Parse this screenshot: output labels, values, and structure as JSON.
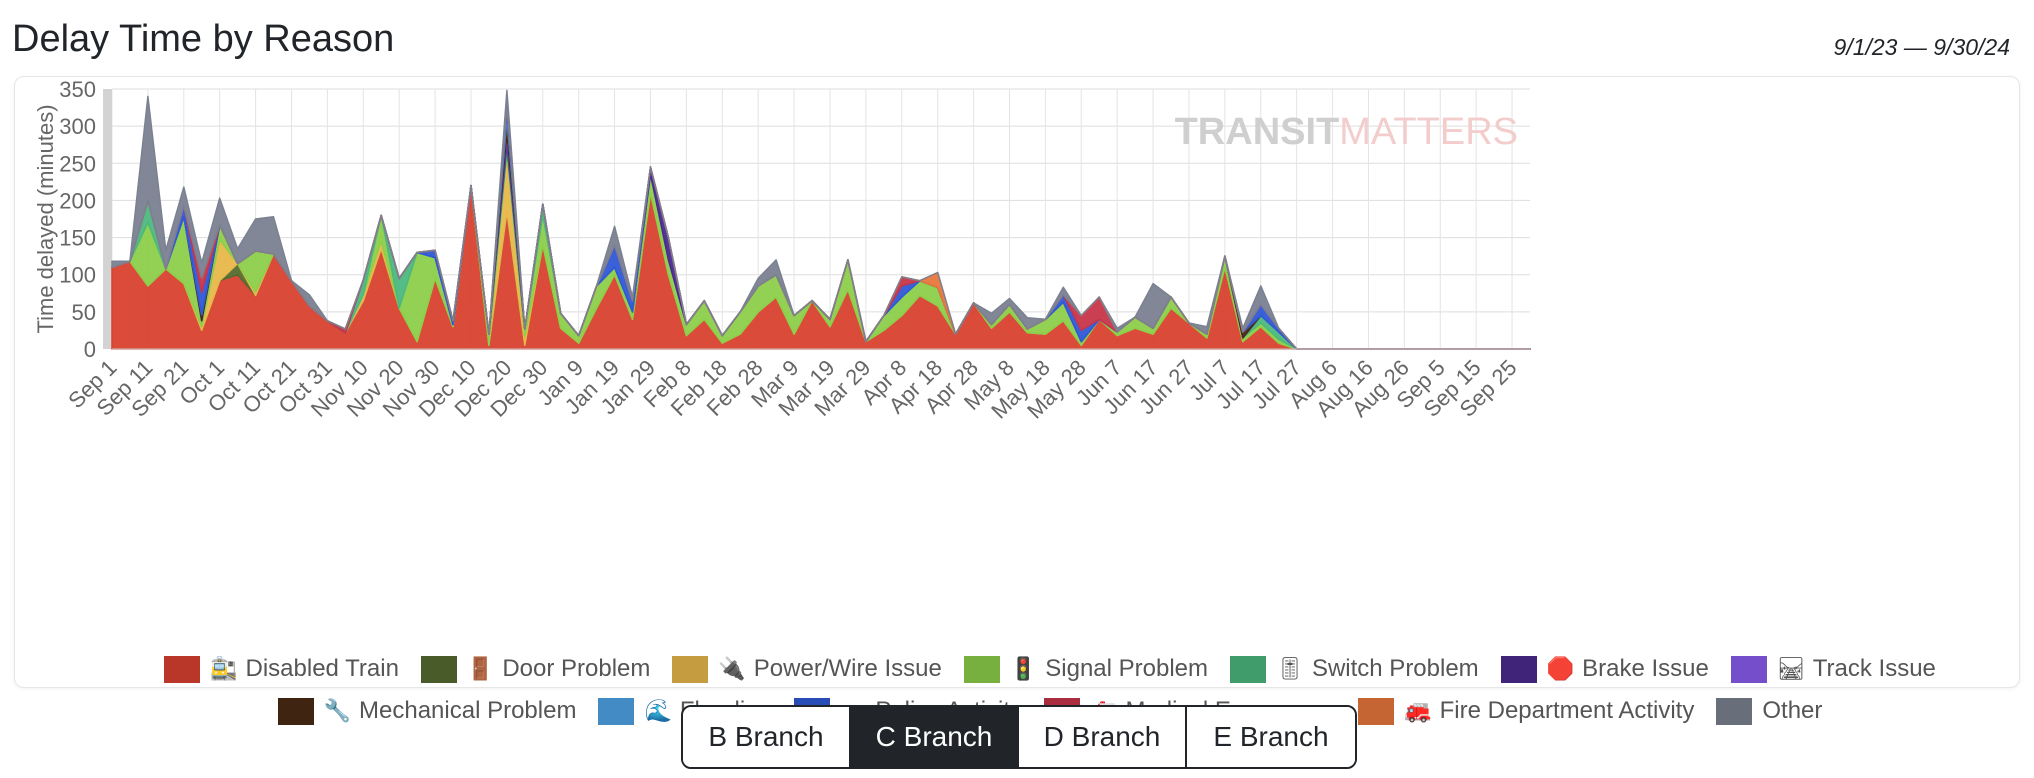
{
  "header": {
    "title": "Delay Time by Reason",
    "date_range": "9/1/23 — 9/30/24"
  },
  "branches": [
    {
      "label": "B Branch",
      "active": false
    },
    {
      "label": "C Branch",
      "active": true
    },
    {
      "label": "D Branch",
      "active": false
    },
    {
      "label": "E Branch",
      "active": false
    }
  ],
  "chart_data": {
    "type": "area",
    "stacked": true,
    "title": "",
    "ylabel": "Time delayed (minutes)",
    "xlabel": "",
    "ylim": [
      0,
      350
    ],
    "y_ticks": [
      0,
      50,
      100,
      150,
      200,
      250,
      300,
      350
    ],
    "x_tick_labels": [
      "Sep 1",
      "Sep 11",
      "Sep 21",
      "Oct 1",
      "Oct 11",
      "Oct 21",
      "Oct 31",
      "Nov 10",
      "Nov 20",
      "Nov 30",
      "Dec 10",
      "Dec 20",
      "Dec 30",
      "Jan 9",
      "Jan 19",
      "Jan 29",
      "Feb 8",
      "Feb 18",
      "Feb 28",
      "Mar 9",
      "Mar 19",
      "Mar 29",
      "Apr 8",
      "Apr 18",
      "Apr 28",
      "May 8",
      "May 18",
      "May 28",
      "Jun 7",
      "Jun 17",
      "Jun 27",
      "Jul 7",
      "Jul 17",
      "Jul 27",
      "Aug 6",
      "Aug 16",
      "Aug 26",
      "Sep 5",
      "Sep 15",
      "Sep 25"
    ],
    "x": [
      "2023-09-01",
      "2023-09-06",
      "2023-09-11",
      "2023-09-16",
      "2023-09-21",
      "2023-09-26",
      "2023-10-01",
      "2023-10-06",
      "2023-10-11",
      "2023-10-16",
      "2023-10-21",
      "2023-10-26",
      "2023-10-31",
      "2023-11-05",
      "2023-11-10",
      "2023-11-15",
      "2023-11-20",
      "2023-11-25",
      "2023-11-30",
      "2023-12-05",
      "2023-12-10",
      "2023-12-15",
      "2023-12-20",
      "2023-12-25",
      "2023-12-30",
      "2024-01-04",
      "2024-01-09",
      "2024-01-14",
      "2024-01-19",
      "2024-01-24",
      "2024-01-29",
      "2024-02-03",
      "2024-02-08",
      "2024-02-13",
      "2024-02-18",
      "2024-02-23",
      "2024-02-28",
      "2024-03-04",
      "2024-03-09",
      "2024-03-14",
      "2024-03-19",
      "2024-03-24",
      "2024-03-29",
      "2024-04-03",
      "2024-04-08",
      "2024-04-13",
      "2024-04-18",
      "2024-04-23",
      "2024-04-28",
      "2024-05-03",
      "2024-05-08",
      "2024-05-13",
      "2024-05-18",
      "2024-05-23",
      "2024-05-28",
      "2024-06-02",
      "2024-06-07",
      "2024-06-12",
      "2024-06-17",
      "2024-06-22",
      "2024-06-27",
      "2024-07-02",
      "2024-07-07",
      "2024-07-12",
      "2024-07-17",
      "2024-07-22",
      "2024-07-27",
      "2024-08-01",
      "2024-08-06",
      "2024-08-11",
      "2024-08-16",
      "2024-08-21",
      "2024-08-26",
      "2024-08-31",
      "2024-09-05",
      "2024-09-10",
      "2024-09-15",
      "2024-09-20",
      "2024-09-25",
      "2024-09-30"
    ],
    "series": [
      {
        "name": "Disabled Train",
        "icon": "🚉",
        "color": "#d9412f",
        "values": [
          110,
          118,
          85,
          108,
          88,
          25,
          92,
          100,
          72,
          128,
          92,
          58,
          38,
          22,
          65,
          135,
          55,
          10,
          95,
          30,
          220,
          5,
          185,
          5,
          140,
          28,
          8,
          55,
          100,
          40,
          210,
          100,
          18,
          40,
          8,
          20,
          50,
          70,
          20,
          65,
          30,
          80,
          10,
          25,
          45,
          72,
          58,
          20,
          62,
          28,
          50,
          22,
          20,
          38,
          5,
          40,
          18,
          28,
          20,
          55,
          35,
          15,
          110,
          10,
          30,
          8
        ]
      },
      {
        "name": "Door Problem",
        "icon": "🚪",
        "color": "#556b2f",
        "values": [
          0,
          0,
          0,
          0,
          0,
          0,
          0,
          15,
          0,
          0,
          0,
          0,
          0,
          0,
          0,
          0,
          0,
          0,
          0,
          0,
          0,
          0,
          0,
          0,
          0,
          0,
          0,
          0,
          0,
          0,
          0,
          0,
          0,
          0,
          0,
          0,
          0,
          0,
          0,
          0,
          0,
          0,
          0,
          0,
          0,
          0,
          0,
          0,
          0,
          0,
          0,
          0,
          0,
          0,
          0,
          0,
          0,
          0,
          0,
          0,
          0,
          0,
          0,
          0,
          0,
          0
        ]
      },
      {
        "name": "Power/Wire Issue",
        "icon": "🔌",
        "color": "#e8b84a",
        "values": [
          0,
          0,
          0,
          0,
          0,
          5,
          55,
          0,
          5,
          0,
          0,
          0,
          0,
          0,
          8,
          10,
          0,
          0,
          0,
          0,
          0,
          0,
          80,
          12,
          0,
          0,
          0,
          0,
          0,
          0,
          0,
          0,
          0,
          0,
          0,
          0,
          0,
          0,
          0,
          0,
          0,
          0,
          0,
          0,
          0,
          0,
          0,
          0,
          0,
          0,
          0,
          0,
          0,
          0,
          0,
          0,
          0,
          0,
          0,
          0,
          0,
          0,
          0,
          0,
          0,
          0
        ]
      },
      {
        "name": "Signal Problem",
        "icon": "🚦",
        "color": "#8ccf4a",
        "values": [
          0,
          0,
          85,
          0,
          90,
          8,
          20,
          0,
          55,
          0,
          0,
          0,
          0,
          0,
          0,
          35,
          0,
          120,
          28,
          3,
          0,
          15,
          0,
          10,
          40,
          20,
          10,
          30,
          10,
          10,
          25,
          20,
          15,
          25,
          10,
          30,
          35,
          30,
          25,
          0,
          10,
          40,
          0,
          20,
          25,
          20,
          25,
          0,
          0,
          5,
          10,
          5,
          20,
          25,
          5,
          0,
          5,
          15,
          8,
          15,
          0,
          5,
          15,
          5,
          5,
          5
        ]
      },
      {
        "name": "Switch Problem",
        "icon": "🎚",
        "color": "#4cb87e",
        "values": [
          0,
          0,
          30,
          0,
          0,
          0,
          0,
          0,
          0,
          0,
          0,
          0,
          0,
          0,
          20,
          0,
          40,
          0,
          0,
          0,
          0,
          0,
          10,
          0,
          15,
          0,
          0,
          0,
          0,
          0,
          0,
          0,
          0,
          0,
          0,
          0,
          0,
          0,
          0,
          0,
          0,
          0,
          0,
          0,
          0,
          0,
          0,
          0,
          0,
          0,
          0,
          0,
          0,
          0,
          0,
          0,
          0,
          0,
          0,
          0,
          0,
          0,
          0,
          0,
          10,
          10
        ]
      },
      {
        "name": "Brake Issue",
        "icon": "🛑",
        "color": "#4b2a8f",
        "values": [
          0,
          0,
          0,
          0,
          0,
          0,
          0,
          0,
          0,
          0,
          0,
          0,
          0,
          0,
          0,
          0,
          0,
          0,
          0,
          0,
          0,
          0,
          10,
          0,
          0,
          0,
          0,
          0,
          0,
          0,
          10,
          30,
          0,
          0,
          0,
          0,
          0,
          0,
          0,
          0,
          0,
          0,
          0,
          0,
          0,
          0,
          0,
          0,
          0,
          0,
          0,
          0,
          0,
          0,
          0,
          0,
          0,
          0,
          0,
          0,
          0,
          0,
          0,
          0,
          0,
          0
        ]
      },
      {
        "name": "Track Issue",
        "icon": "🛤",
        "color": "#8a5cf0",
        "values": [
          0,
          0,
          0,
          0,
          0,
          0,
          0,
          0,
          0,
          0,
          0,
          0,
          0,
          0,
          0,
          0,
          0,
          0,
          0,
          0,
          0,
          0,
          5,
          0,
          0,
          0,
          0,
          0,
          0,
          0,
          0,
          0,
          0,
          0,
          0,
          0,
          0,
          0,
          0,
          0,
          0,
          0,
          0,
          0,
          0,
          0,
          0,
          0,
          0,
          0,
          0,
          0,
          0,
          0,
          0,
          0,
          0,
          0,
          0,
          0,
          0,
          0,
          0,
          0,
          0,
          0
        ]
      },
      {
        "name": "Mechanical Problem",
        "icon": "🔧",
        "color": "#4a2a14",
        "values": [
          0,
          0,
          0,
          0,
          0,
          8,
          0,
          0,
          0,
          0,
          0,
          0,
          0,
          0,
          0,
          0,
          0,
          0,
          0,
          0,
          0,
          0,
          20,
          0,
          0,
          0,
          0,
          0,
          0,
          0,
          0,
          0,
          0,
          0,
          0,
          0,
          0,
          0,
          0,
          0,
          0,
          0,
          0,
          0,
          0,
          0,
          0,
          0,
          0,
          0,
          0,
          0,
          0,
          0,
          0,
          0,
          0,
          0,
          0,
          0,
          0,
          0,
          0,
          8,
          0,
          0
        ]
      },
      {
        "name": "Flooding",
        "icon": "🌊",
        "color": "#4fa3e6",
        "values": [
          0,
          0,
          0,
          0,
          0,
          0,
          0,
          0,
          0,
          0,
          0,
          0,
          0,
          0,
          0,
          0,
          0,
          0,
          0,
          0,
          0,
          0,
          8,
          0,
          0,
          0,
          0,
          0,
          0,
          0,
          0,
          0,
          0,
          0,
          0,
          0,
          0,
          0,
          0,
          0,
          0,
          0,
          0,
          0,
          0,
          0,
          0,
          0,
          0,
          0,
          0,
          0,
          0,
          0,
          0,
          0,
          0,
          0,
          0,
          0,
          0,
          0,
          0,
          0,
          0,
          0
        ]
      },
      {
        "name": "Police Activity",
        "icon": "🚓",
        "color": "#2f59d6",
        "values": [
          0,
          0,
          0,
          0,
          15,
          30,
          0,
          0,
          0,
          0,
          0,
          0,
          0,
          0,
          0,
          0,
          0,
          0,
          10,
          5,
          0,
          0,
          10,
          0,
          0,
          0,
          0,
          0,
          30,
          15,
          0,
          0,
          0,
          0,
          0,
          0,
          0,
          0,
          0,
          0,
          0,
          0,
          0,
          0,
          15,
          0,
          0,
          0,
          0,
          0,
          0,
          0,
          0,
          10,
          15,
          0,
          0,
          0,
          0,
          0,
          0,
          0,
          0,
          0,
          15,
          5
        ]
      },
      {
        "name": "Medical Emergency",
        "icon": "🚑",
        "color": "#c8354a",
        "values": [
          0,
          0,
          0,
          0,
          0,
          20,
          0,
          0,
          0,
          0,
          0,
          0,
          0,
          5,
          0,
          0,
          0,
          0,
          0,
          0,
          0,
          0,
          0,
          0,
          0,
          0,
          0,
          0,
          0,
          0,
          0,
          0,
          0,
          0,
          0,
          0,
          0,
          0,
          0,
          0,
          0,
          0,
          0,
          0,
          12,
          0,
          0,
          0,
          0,
          0,
          0,
          0,
          0,
          0,
          20,
          30,
          0,
          0,
          0,
          0,
          0,
          0,
          0,
          0,
          0,
          0
        ]
      },
      {
        "name": "Fire Department Activity",
        "icon": "🚒",
        "color": "#e8773c",
        "values": [
          0,
          0,
          0,
          0,
          0,
          0,
          0,
          0,
          0,
          0,
          0,
          0,
          0,
          0,
          0,
          0,
          0,
          0,
          0,
          0,
          0,
          0,
          0,
          0,
          0,
          0,
          0,
          0,
          0,
          0,
          0,
          0,
          0,
          0,
          0,
          0,
          0,
          0,
          0,
          0,
          0,
          0,
          0,
          0,
          0,
          0,
          20,
          0,
          0,
          0,
          0,
          0,
          0,
          0,
          0,
          0,
          0,
          0,
          0,
          0,
          0,
          0,
          0,
          0,
          0,
          0
        ]
      },
      {
        "name": "Other",
        "icon": "",
        "color": "#7b8191",
        "values": [
          8,
          0,
          140,
          25,
          25,
          20,
          36,
          20,
          43,
          50,
          0,
          15,
          0,
          0,
          0,
          0,
          0,
          0,
          0,
          0,
          0,
          0,
          20,
          0,
          0,
          0,
          0,
          0,
          25,
          5,
          0,
          0,
          0,
          0,
          0,
          0,
          10,
          20,
          0,
          0,
          0,
          0,
          0,
          0,
          0,
          0,
          0,
          0,
          0,
          15,
          8,
          15,
          0,
          10,
          0,
          0,
          5,
          0,
          60,
          0,
          0,
          10,
          0,
          5,
          25,
          0
        ]
      }
    ],
    "grid": true,
    "legend_position": "bottom",
    "watermark": {
      "brand": "TRANSIT",
      "rest": "MATTERS"
    }
  }
}
